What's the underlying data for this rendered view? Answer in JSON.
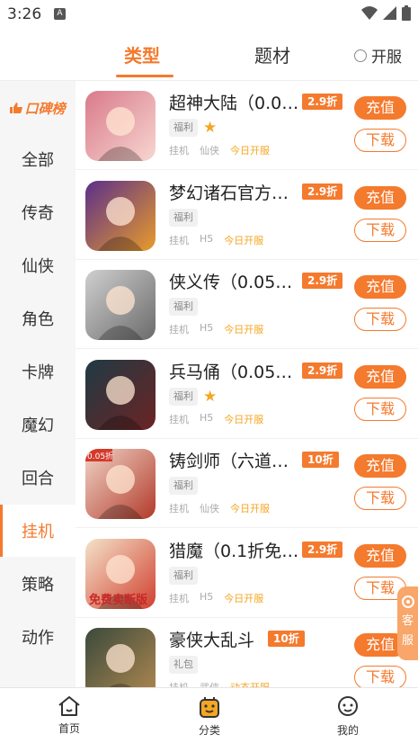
{
  "status_bar": {
    "time": "3:26",
    "notification": "A"
  },
  "tabs": {
    "type_label": "类型",
    "theme_label": "题材",
    "kaifu_label": "开服"
  },
  "sidebar": {
    "title": "口碑榜",
    "items": [
      {
        "label": "全部"
      },
      {
        "label": "传奇"
      },
      {
        "label": "仙侠"
      },
      {
        "label": "角色"
      },
      {
        "label": "卡牌"
      },
      {
        "label": "魔幻"
      },
      {
        "label": "回合"
      },
      {
        "label": "挂机",
        "active": true
      },
      {
        "label": "策略"
      },
      {
        "label": "动作"
      }
    ]
  },
  "games": [
    {
      "name": "超神大陆（0.0…",
      "discount": "2.9折",
      "tag": "福利",
      "star": true,
      "meta": [
        "挂机",
        "仙侠",
        "今日开服"
      ],
      "charge": "充值",
      "download": "下载",
      "colors": [
        "#d97a8b",
        "#f7d6d0"
      ]
    },
    {
      "name": "梦幻诸石官方…",
      "discount": "2.9折",
      "tag": "福利",
      "star": false,
      "meta": [
        "挂机",
        "H5",
        "今日开服"
      ],
      "charge": "充值",
      "download": "下载",
      "colors": [
        "#5b2f8a",
        "#e89b2b"
      ]
    },
    {
      "name": "侠义传（0.05…",
      "discount": "2.9折",
      "tag": "福利",
      "star": false,
      "meta": [
        "挂机",
        "H5",
        "今日开服"
      ],
      "charge": "充值",
      "download": "下载",
      "colors": [
        "#cfcfcf",
        "#6b6b6b"
      ]
    },
    {
      "name": "兵马俑（0.05…",
      "discount": "2.9折",
      "tag": "福利",
      "star": true,
      "meta": [
        "挂机",
        "H5",
        "今日开服"
      ],
      "charge": "充值",
      "download": "下载",
      "colors": [
        "#1f3a44",
        "#6b2424"
      ]
    },
    {
      "name": "铸剑师（六道…",
      "discount": "10折",
      "tag": "福利",
      "star": false,
      "meta": [
        "挂机",
        "仙侠",
        "今日开服"
      ],
      "charge": "充值",
      "download": "下载",
      "colors": [
        "#f0d5c8",
        "#b23a2a"
      ],
      "badge": "0.05折"
    },
    {
      "name": "猎魔（0.1折免…",
      "discount": "2.9折",
      "tag": "福利",
      "star": false,
      "meta": [
        "挂机",
        "H5",
        "今日开服"
      ],
      "charge": "充值",
      "download": "下载",
      "colors": [
        "#f4e2c9",
        "#d0402f"
      ],
      "overlay_text": "免费卖断版"
    },
    {
      "name": "豪侠大乱斗",
      "discount": "10折",
      "tag": "礼包",
      "star": false,
      "meta": [
        "挂机",
        "武侠",
        "动态开服"
      ],
      "charge": "充值",
      "download": "下载",
      "colors": [
        "#3a4a3c",
        "#b08850"
      ]
    }
  ],
  "service": {
    "label_1": "客",
    "label_2": "服"
  },
  "bottom_nav": [
    {
      "label": "首页",
      "icon": "home-icon"
    },
    {
      "label": "分类",
      "icon": "category-icon"
    },
    {
      "label": "我的",
      "icon": "profile-icon"
    }
  ],
  "accent_color": "#f47a2e"
}
